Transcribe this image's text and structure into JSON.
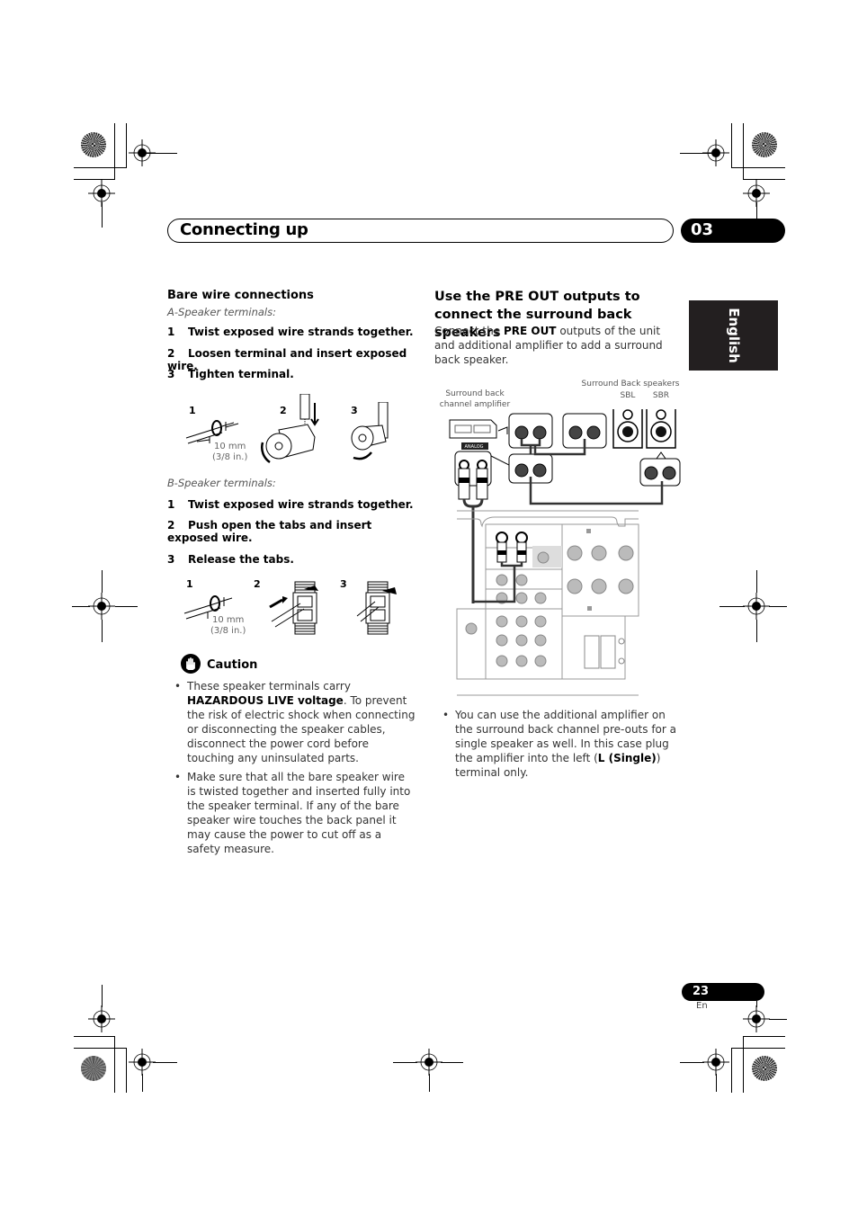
{
  "header": {
    "chapter_title": "Connecting up",
    "chapter_number": "03"
  },
  "language_tab": "English",
  "left": {
    "section_title": "Bare wire connections",
    "a_speaker": {
      "subtitle": "A-Speaker terminals:",
      "steps": [
        {
          "num": "1",
          "text": "Twist exposed wire strands together."
        },
        {
          "num": "2",
          "text": "Loosen terminal and insert exposed wire."
        },
        {
          "num": "3",
          "text": "Tighten terminal."
        }
      ],
      "figure": {
        "labels": [
          "1",
          "2",
          "3"
        ],
        "dimension_line1": "10 mm",
        "dimension_line2": "(3/8 in.)"
      }
    },
    "b_speaker": {
      "subtitle": "B-Speaker terminals:",
      "steps": [
        {
          "num": "1",
          "text": "Twist exposed wire strands together."
        },
        {
          "num": "2",
          "text": "Push open the tabs and insert exposed wire."
        },
        {
          "num": "3",
          "text": "Release the tabs."
        }
      ],
      "figure": {
        "labels": [
          "1",
          "2",
          "3"
        ],
        "dimension_line1": "10 mm",
        "dimension_line2": "(3/8 in.)"
      }
    },
    "caution": {
      "title": "Caution",
      "bullets": [
        {
          "pre": "These speaker terminals carry ",
          "bold": "HAZARDOUS LIVE voltage",
          "post": ". To prevent the risk of electric shock when connecting or disconnecting the speaker cables, disconnect the power cord before touching any uninsulated parts."
        },
        {
          "pre": "Make sure that all the bare speaker wire is twisted together and inserted fully into the speaker terminal. If any of the bare speaker wire touches the back panel it may cause the power to cut off as a safety measure.",
          "bold": "",
          "post": ""
        }
      ]
    }
  },
  "right": {
    "section_title": "Use the PRE OUT outputs to connect the surround back speakers",
    "intro": {
      "pre": "Connect the ",
      "bold": "PRE OUT",
      "post": " outputs of the unit and additional amplifier to add a surround back speaker."
    },
    "diagram": {
      "amp_label_line1": "Surround back",
      "amp_label_line2": "channel amplifier",
      "speakers_label": "Surround Back speakers",
      "sbl": "SBL",
      "sbr": "SBR",
      "analog_label": "ANALOG",
      "input_label": "INPUT",
      "input_l": "L",
      "input_r": "R"
    },
    "note": {
      "pre": "You can use the additional amplifier on the surround back channel pre-outs for a single speaker as well. In this case plug the amplifier into the left (",
      "bold": "L (Single)",
      "post": ") terminal only."
    }
  },
  "footer": {
    "page_number": "23",
    "language_code": "En"
  }
}
